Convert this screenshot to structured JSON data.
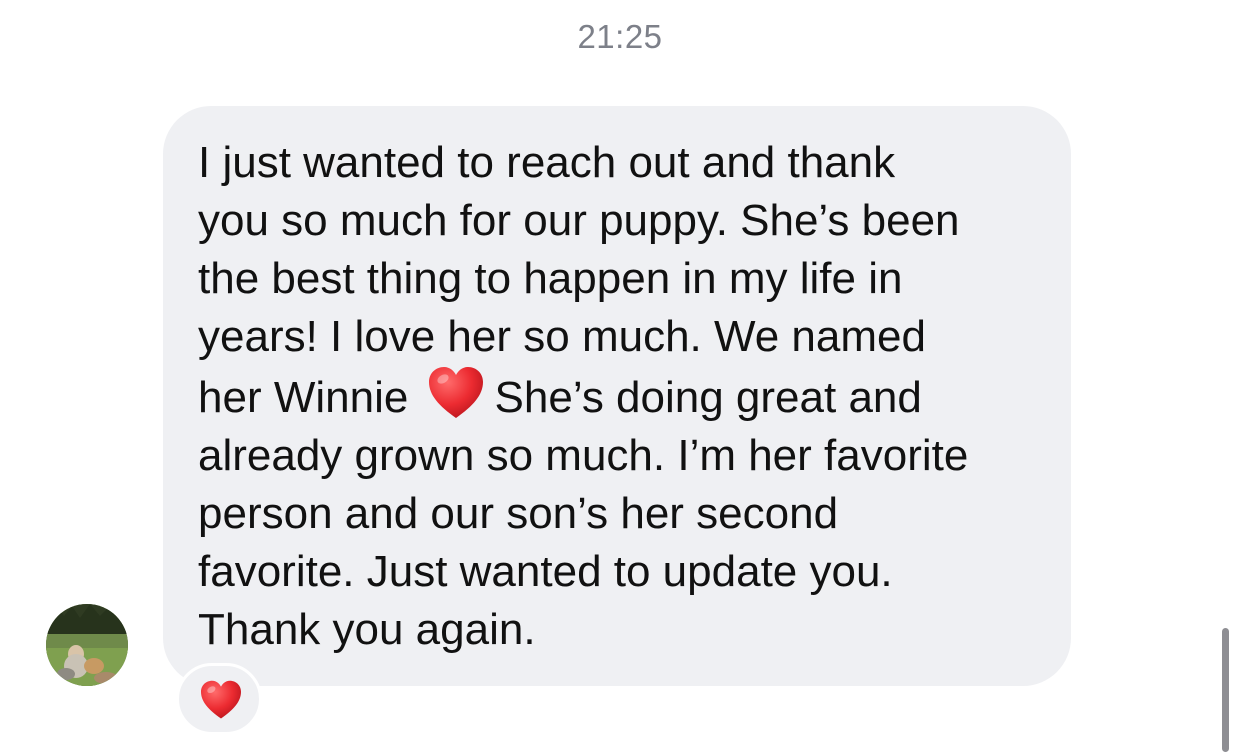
{
  "conversation": {
    "timestamp": "21:25"
  },
  "message": {
    "text_before_emoji": "I just wanted to reach out and thank\nyou so much for our puppy. She’s been\nthe best thing to happen in my life in\nyears! I love her so much. We named\nher Winnie",
    "inline_emoji": "heart-icon",
    "text_after_emoji": "She’s doing great and\nalready grown so much. I’m her favorite\nperson and our son’s her second\nfavorite. Just wanted to update you.\nThank you again.",
    "reaction": "heart-icon"
  },
  "colors": {
    "bubble_background": "#eff0f3",
    "timestamp_text": "#7d8089",
    "message_text": "#111111",
    "heart": "#e8262c"
  }
}
